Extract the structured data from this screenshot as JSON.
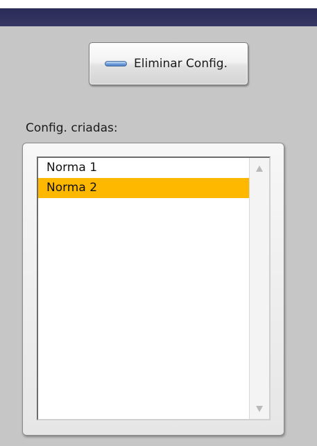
{
  "toolbar": {
    "delete_config_label": "Eliminar Config.",
    "delete_config_icon": "minus-bar-icon",
    "icon_color": "#6c9bd8"
  },
  "config_list": {
    "caption": "Config. criadas:",
    "items": [
      {
        "label": "Norma 1",
        "selected": false
      },
      {
        "label": "Norma 2",
        "selected": true
      }
    ],
    "selection_color": "#ffb800",
    "scroll_up_icon": "triangle-up-icon",
    "scroll_down_icon": "triangle-down-icon"
  },
  "colors": {
    "title_bar": "#33335f",
    "window_background": "#c6c6c6"
  }
}
